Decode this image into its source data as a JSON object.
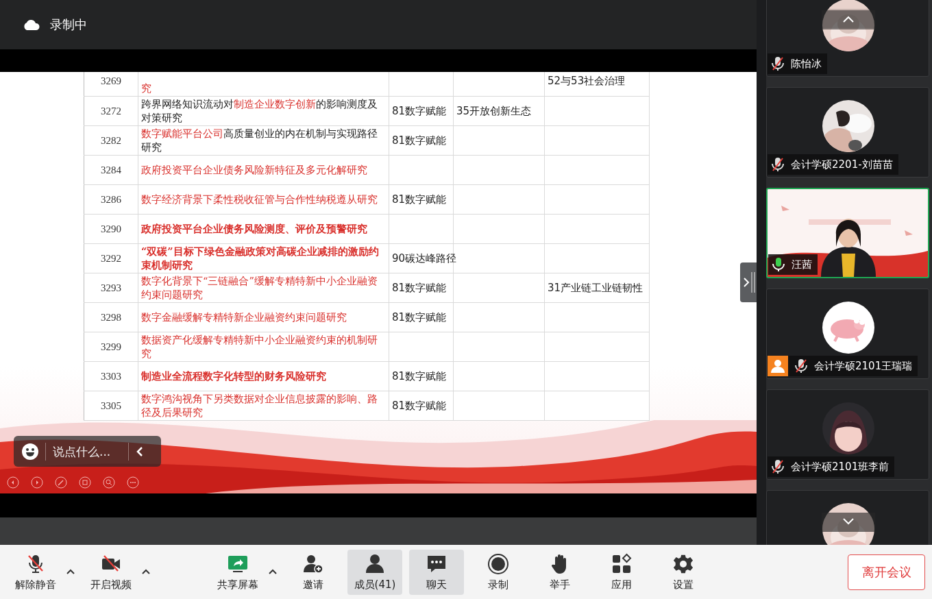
{
  "recording": {
    "label": "录制中"
  },
  "slide": {
    "table": {
      "rows": [
        {
          "number": "3269",
          "bold": false,
          "title": [
            {
              "text": "究",
              "highlight": true
            }
          ],
          "column_5": "52与53社会治理"
        },
        {
          "number": "3272",
          "bold": false,
          "title": [
            {
              "text": "跨界网络知识流动对",
              "highlight": false
            },
            {
              "text": "制造企业数字创新",
              "highlight": true
            },
            {
              "text": "的影响测度及对策研究",
              "highlight": false
            }
          ],
          "column_3": "81数字赋能",
          "column_4": "35开放创新生态"
        },
        {
          "number": "3282",
          "bold": false,
          "title": [
            {
              "text": "数字赋能平台公司",
              "highlight": true
            },
            {
              "text": "高质量创业的内在机制与实现路径研究",
              "highlight": false
            }
          ],
          "column_3": "81数字赋能"
        },
        {
          "number": "3284",
          "bold": false,
          "title": [
            {
              "text": "政府投资平台企业债务风险新特征及多元化解研究",
              "highlight": true
            }
          ]
        },
        {
          "number": "3286",
          "bold": false,
          "title": [
            {
              "text": "数字经济背景下柔性税收征管与合作性纳税遵从研究",
              "highlight": true
            }
          ],
          "column_3": "81数字赋能"
        },
        {
          "number": "3290",
          "bold": true,
          "title": [
            {
              "text": "政府投资平台企业债务风险测度、评价及预警研究",
              "highlight": true
            }
          ]
        },
        {
          "number": "3292",
          "bold": true,
          "title": [
            {
              "text": "“双碳”目标下绿色金融政策对高碳企业减排的激励约束机制研究",
              "highlight": true
            }
          ],
          "column_3": "90碳达峰路径"
        },
        {
          "number": "3293",
          "bold": false,
          "title": [
            {
              "text": "数字化背景下“三链融合”缓解专精特新中小企业融资约束问题研究",
              "highlight": true
            }
          ],
          "column_3": "81数字赋能",
          "column_5": "31产业链工业链韧性"
        },
        {
          "number": "3298",
          "bold": false,
          "title": [
            {
              "text": "数字金融缓解专精特新企业融资约束问题研究",
              "highlight": true
            }
          ],
          "column_3": "81数字赋能"
        },
        {
          "number": "3299",
          "bold": false,
          "title": [
            {
              "text": "数据资产化缓解专精特新中小企业融资约束的机制研究",
              "highlight": true
            }
          ]
        },
        {
          "number": "3303",
          "bold": true,
          "title": [
            {
              "text": "制造业全流程数字化转型的财务风险研究",
              "highlight": true
            }
          ],
          "column_3": "81数字赋能"
        },
        {
          "number": "3305",
          "bold": false,
          "title": [
            {
              "text": "数字鸿沟视角下另类数据对企业信息披露的影响、路径及后果研究",
              "highlight": true
            }
          ],
          "column_3": "81数字赋能"
        }
      ]
    },
    "chat": {
      "placeholder": "说点什么..."
    }
  },
  "participants": [
    {
      "name": "陈怡冰",
      "muted": true,
      "selected": false,
      "host": false,
      "kind": "picture"
    },
    {
      "name": "会计学硕2201-刘苗苗",
      "muted": true,
      "selected": false,
      "host": false,
      "kind": "picture"
    },
    {
      "name": "汪茜",
      "muted": false,
      "selected": true,
      "host": false,
      "kind": "video"
    },
    {
      "name": "会计学硕2101王瑞瑞",
      "muted": true,
      "selected": false,
      "host": true,
      "kind": "picture"
    },
    {
      "name": "会计学硕2101班李前",
      "muted": true,
      "selected": false,
      "host": false,
      "kind": "picture"
    },
    {
      "selected": false,
      "kind": "picture"
    }
  ],
  "toolbar": {
    "items": [
      {
        "label": "解除静音",
        "off": true,
        "has_menu": true,
        "selected": false
      },
      {
        "label": "开启视频",
        "off": true,
        "has_menu": true,
        "selected": false
      },
      {
        "label": "共享屏幕",
        "has_menu": true,
        "selected": false
      },
      {
        "label": "邀请",
        "selected": false
      },
      {
        "label": "成员(41)",
        "selected": true
      },
      {
        "label": "聊天",
        "selected": true
      },
      {
        "label": "录制",
        "selected": false
      },
      {
        "label": "举手",
        "selected": false
      },
      {
        "label": "应用",
        "selected": false
      },
      {
        "label": "设置",
        "selected": false
      }
    ],
    "leave_button": "离开会议"
  }
}
